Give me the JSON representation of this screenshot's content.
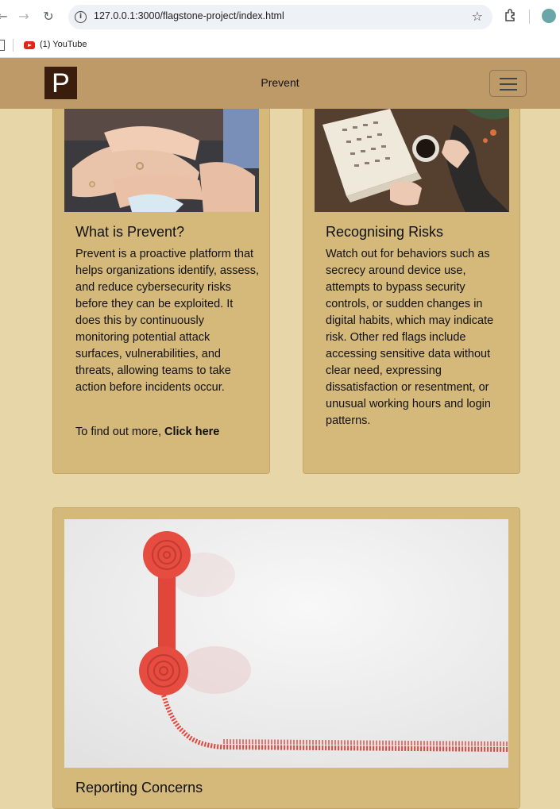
{
  "browser": {
    "url": "127.0.0.1:3000/flagstone-project/index.html",
    "bookmarks": [
      {
        "label": "(1) YouTube",
        "icon": "youtube-icon"
      }
    ]
  },
  "navbar": {
    "logo_letter": "P",
    "title": "Prevent",
    "colors": {
      "bar": "#bf9a69",
      "logo_bg": "#3a1d0c"
    }
  },
  "cards": [
    {
      "title": "What is Prevent?",
      "body": "Prevent is a proactive platform that helps organizations identify, assess, and reduce cybersecurity risks before they can be exploited. It does this by continuously monitoring potential attack surfaces, vulnerabilities, and threats, allowing teams to take action before incidents occur.",
      "more_prefix": "To find out more, ",
      "more_link": "Click here",
      "image": "hands-together-image"
    },
    {
      "title": "Recognising Risks",
      "body": "Watch out for behaviors such as secrecy around device use, attempts to bypass security controls, or sudden changes in digital habits, which may indicate risk. Other red flags include accessing sensitive data without clear need, expressing dissatisfaction or resentment, or unusual working hours and login patterns.",
      "image": "book-and-coffee-image"
    },
    {
      "title": "Reporting Concerns",
      "image": "red-telephone-image"
    }
  ],
  "colors": {
    "page_bg": "#e7d6a8",
    "card_bg": "#d5b97b"
  }
}
